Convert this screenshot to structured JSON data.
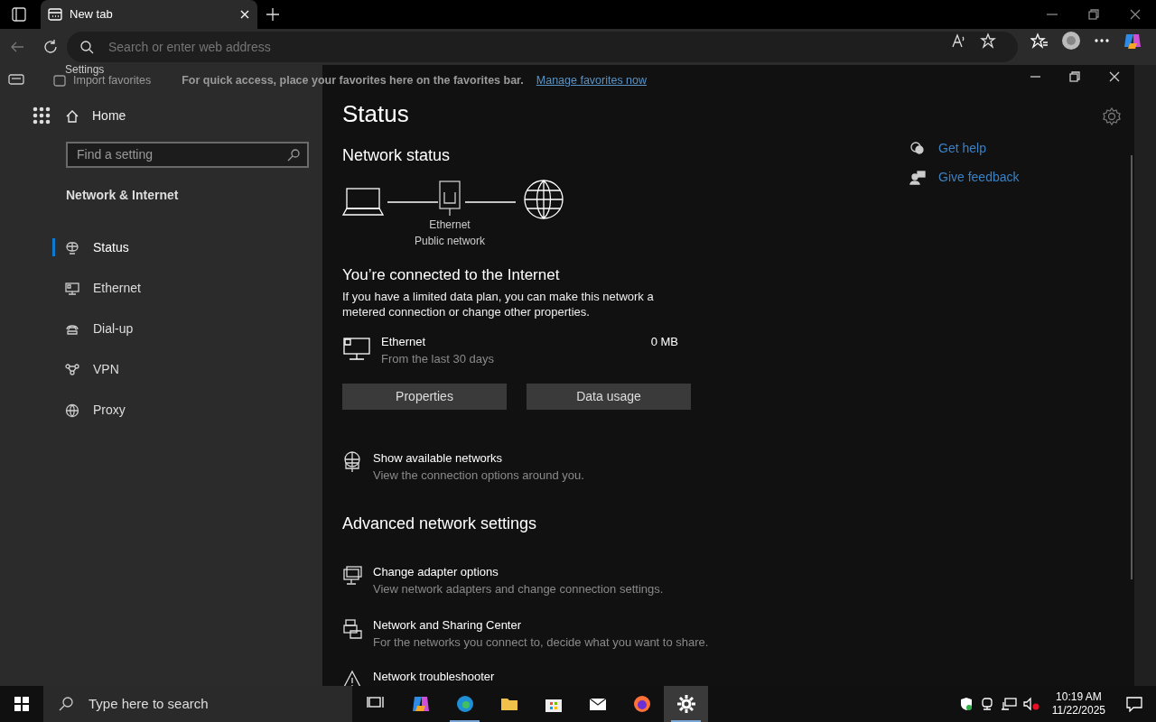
{
  "browser": {
    "tab": {
      "title": "New tab"
    },
    "address_bar": {
      "placeholder": "Search or enter web address"
    },
    "favorites_bar": {
      "import": "Import favorites",
      "hint": "For quick access, place your favorites here on the favorites bar.",
      "link": "Manage favorites now"
    }
  },
  "settings": {
    "title": "Settings",
    "home": "Home",
    "search": {
      "placeholder": "Find a setting"
    },
    "section": "Network & Internet",
    "nav": [
      {
        "label": "Status",
        "kind": "status",
        "selected": true
      },
      {
        "label": "Ethernet",
        "kind": "ethernet",
        "selected": false
      },
      {
        "label": "Dial-up",
        "kind": "dialup",
        "selected": false
      },
      {
        "label": "VPN",
        "kind": "vpn",
        "selected": false
      },
      {
        "label": "Proxy",
        "kind": "proxy",
        "selected": false
      }
    ],
    "page_title": "Status",
    "network_status": "Network status",
    "diagram": {
      "adapter": "Ethernet",
      "network": "Public network"
    },
    "connected_title": "You’re connected to the Internet",
    "connected_text": "If you have a limited data plan, you can make this network a metered connection or change other properties.",
    "usage": {
      "name": "Ethernet",
      "period": "From the last 30 days",
      "amount": "0 MB"
    },
    "buttons": [
      "Properties",
      "Data usage"
    ],
    "show_networks": {
      "title": "Show available networks",
      "subtitle": "View the connection options around you."
    },
    "advanced_title": "Advanced network settings",
    "advanced": [
      {
        "kind": "adapter",
        "title": "Change adapter options",
        "subtitle": "View network adapters and change connection settings."
      },
      {
        "kind": "sharing",
        "title": "Network and Sharing Center",
        "subtitle": "For the networks you connect to, decide what you want to share."
      },
      {
        "kind": "troubleshooter",
        "title": "Network troubleshooter"
      }
    ],
    "help_links": [
      {
        "kind": "help",
        "label": "Get help"
      },
      {
        "kind": "feedback",
        "label": "Give feedback"
      }
    ]
  },
  "taskbar": {
    "search": {
      "placeholder": "Type here to search"
    },
    "apps": [
      {
        "kind": "taskview",
        "running": false,
        "selected": false
      },
      {
        "kind": "copilot",
        "running": false,
        "selected": false
      },
      {
        "kind": "edge",
        "running": true,
        "selected": false
      },
      {
        "kind": "explorer",
        "running": false,
        "selected": false
      },
      {
        "kind": "store",
        "running": false,
        "selected": false
      },
      {
        "kind": "mail",
        "running": false,
        "selected": false
      },
      {
        "kind": "firefox",
        "running": false,
        "selected": false
      },
      {
        "kind": "settings",
        "running": true,
        "selected": true
      }
    ],
    "clock": {
      "time": "10:19 AM",
      "date": "11/22/2025"
    }
  }
}
